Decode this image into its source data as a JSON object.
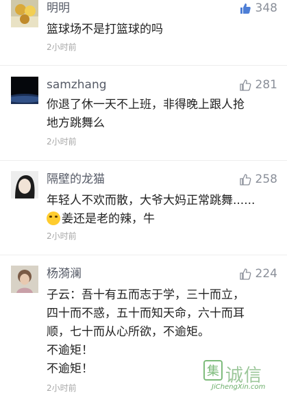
{
  "comments": [
    {
      "username": "明明",
      "likes": "348",
      "liked": true,
      "lines": [
        "篮球场不是打篮球的吗"
      ],
      "time": "2小时前"
    },
    {
      "username": "samzhang",
      "likes": "281",
      "liked": false,
      "lines": [
        "你退了休一天不上班，非得晚上跟人抢",
        "地方跳舞么"
      ],
      "time": "2小时前"
    },
    {
      "username": "隔壁的龙猫",
      "likes": "258",
      "liked": false,
      "lines": [
        "年轻人不欢而散，大爷大妈正常跳舞......",
        "姜还是老的辣，牛"
      ],
      "emoji": "laughing-emoji",
      "time": "2小时前"
    },
    {
      "username": "杨漪澜",
      "likes": "224",
      "liked": false,
      "lines": [
        "子云：吾十有五而志于学，三十而立，",
        "四十而不惑，五十而知天命，六十而耳",
        "顺，七十而从心所欲，不逾矩。",
        "不逾矩！",
        "不逾矩！"
      ],
      "time": "2小时前"
    }
  ],
  "watermark": {
    "brand_cn": "诚信",
    "brand_char": "集",
    "domain": "JiChengXin.com"
  },
  "colors": {
    "like_active": "#4d7ed6",
    "like_idle": "#8a8f99"
  }
}
